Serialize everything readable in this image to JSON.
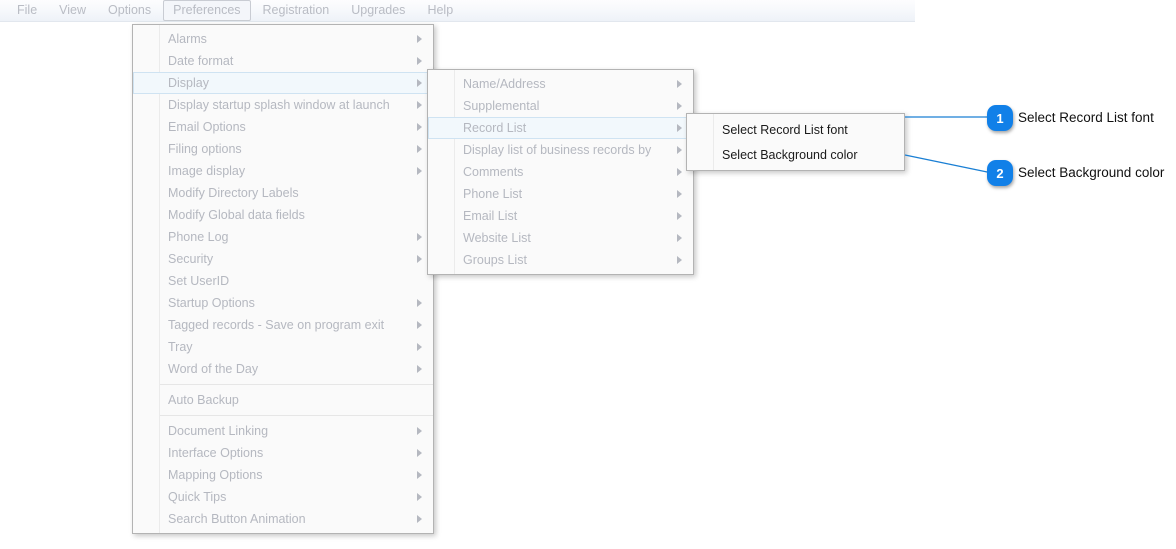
{
  "menubar": {
    "items": [
      {
        "label": "File",
        "active": false
      },
      {
        "label": "View",
        "active": false
      },
      {
        "label": "Options",
        "active": false
      },
      {
        "label": "Preferences",
        "active": true
      },
      {
        "label": "Registration",
        "active": false
      },
      {
        "label": "Upgrades",
        "active": false
      },
      {
        "label": "Help",
        "active": false
      }
    ]
  },
  "colors": {
    "accent_blue": "#1180e8",
    "connector_blue": "#1a7fd4",
    "menu_text": "#b5b8c0",
    "leaf_menu_text": "#1a1a1a",
    "selected_bg": "#f2f8fc",
    "selected_border": "#cfe3f2",
    "panel_bg": "#fafafa",
    "panel_border": "#b3b3b3"
  },
  "preferences_menu": {
    "items": [
      {
        "label": "Alarms",
        "arrow": true,
        "selected": false
      },
      {
        "label": "Date format",
        "arrow": true,
        "selected": false
      },
      {
        "label": "Display",
        "arrow": true,
        "selected": true
      },
      {
        "label": "Display startup splash window at launch",
        "arrow": true,
        "selected": false
      },
      {
        "label": "Email Options",
        "arrow": true,
        "selected": false
      },
      {
        "label": "Filing options",
        "arrow": true,
        "selected": false
      },
      {
        "label": "Image display",
        "arrow": true,
        "selected": false
      },
      {
        "label": "Modify Directory Labels",
        "arrow": false,
        "selected": false
      },
      {
        "label": "Modify Global data fields",
        "arrow": false,
        "selected": false
      },
      {
        "label": "Phone Log",
        "arrow": true,
        "selected": false
      },
      {
        "label": "Security",
        "arrow": true,
        "selected": false
      },
      {
        "label": "Set UserID",
        "arrow": false,
        "selected": false
      },
      {
        "label": "Startup Options",
        "arrow": true,
        "selected": false
      },
      {
        "label": "Tagged records - Save on program exit",
        "arrow": true,
        "selected": false
      },
      {
        "label": "Tray",
        "arrow": true,
        "selected": false
      },
      {
        "label": "Word of the Day",
        "arrow": true,
        "selected": false
      },
      {
        "separator": true
      },
      {
        "label": "Auto Backup",
        "arrow": false,
        "selected": false
      },
      {
        "separator": true
      },
      {
        "label": "Document Linking",
        "arrow": true,
        "selected": false
      },
      {
        "label": "Interface Options",
        "arrow": true,
        "selected": false
      },
      {
        "label": "Mapping Options",
        "arrow": true,
        "selected": false
      },
      {
        "label": "Quick Tips",
        "arrow": true,
        "selected": false
      },
      {
        "label": "Search Button Animation",
        "arrow": true,
        "selected": false
      }
    ]
  },
  "display_menu": {
    "items": [
      {
        "label": "Name/Address",
        "arrow": true,
        "selected": false
      },
      {
        "label": "Supplemental",
        "arrow": true,
        "selected": false
      },
      {
        "label": "Record List",
        "arrow": true,
        "selected": true
      },
      {
        "label": "Display list of business records by",
        "arrow": true,
        "selected": false
      },
      {
        "label": "Comments",
        "arrow": true,
        "selected": false
      },
      {
        "label": "Phone List",
        "arrow": true,
        "selected": false
      },
      {
        "label": "Email List",
        "arrow": true,
        "selected": false
      },
      {
        "label": "Website List",
        "arrow": true,
        "selected": false
      },
      {
        "label": "Groups List",
        "arrow": true,
        "selected": false
      }
    ]
  },
  "record_list_menu": {
    "items": [
      {
        "label": "Select Record List font",
        "arrow": false,
        "selected": false
      },
      {
        "label": "Select Background color",
        "arrow": false,
        "selected": false
      }
    ]
  },
  "callouts": [
    {
      "number": "1",
      "label": "Select Record List font"
    },
    {
      "number": "2",
      "label": "Select Background color"
    }
  ]
}
